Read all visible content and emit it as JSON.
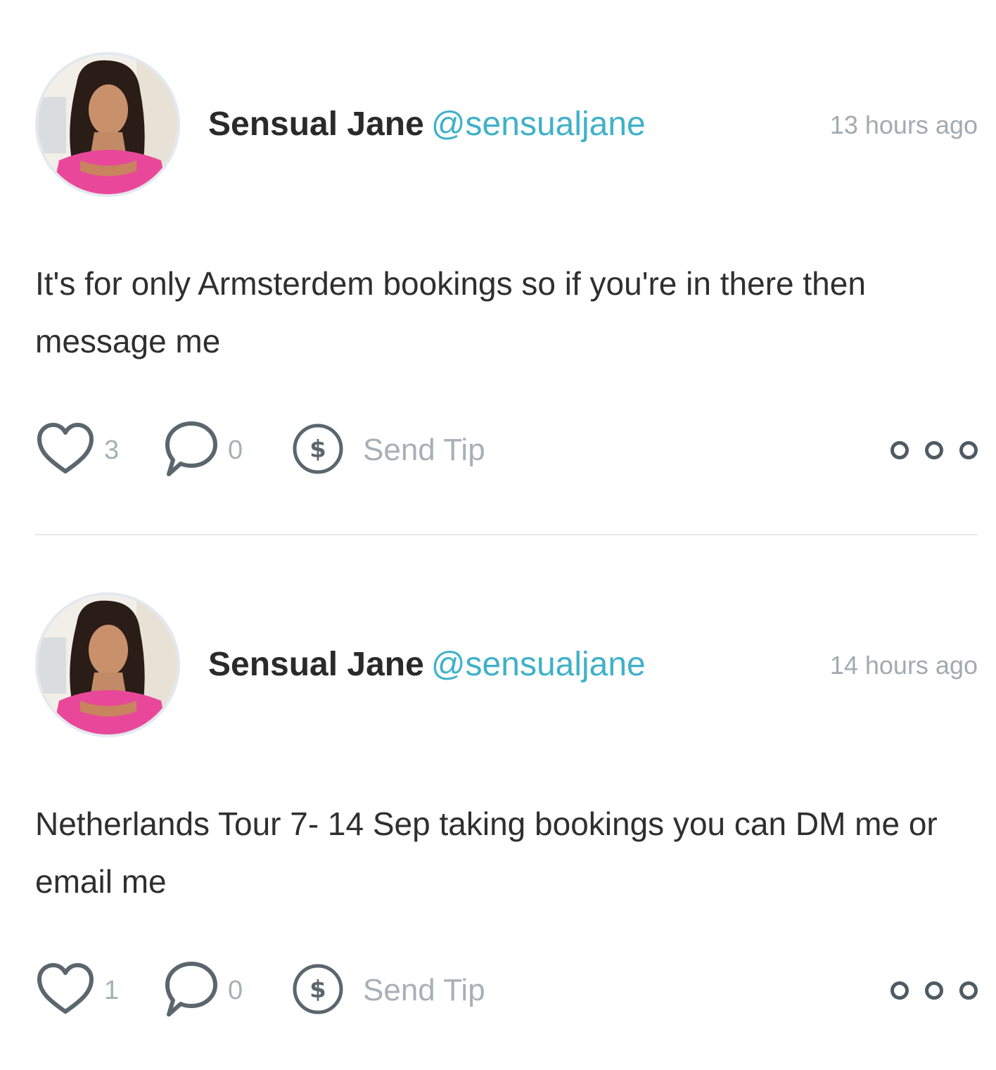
{
  "feed": {
    "posts": [
      {
        "author_name": "Sensual Jane",
        "author_handle": "@sensualjane",
        "time": "13 hours ago",
        "text": "It's for only Armsterdem bookings so if you're in there then message me",
        "likes": "3",
        "comments": "0",
        "tip_label": "Send Tip",
        "icons": {
          "like": "heart-icon",
          "comment": "speech-bubble-icon",
          "tip": "dollar-coin-icon",
          "more": "more-dots-icon"
        }
      },
      {
        "author_name": "Sensual Jane",
        "author_handle": "@sensualjane",
        "time": "14 hours ago",
        "text": "Netherlands Tour 7- 14 Sep taking bookings you can DM me or email me",
        "likes": "1",
        "comments": "0",
        "tip_label": "Send Tip",
        "icons": {
          "like": "heart-icon",
          "comment": "speech-bubble-icon",
          "tip": "dollar-coin-icon",
          "more": "more-dots-icon"
        }
      }
    ]
  },
  "colors": {
    "handle": "#3fb1c9",
    "name": "#2a2a2a",
    "muted": "#a9b0b5",
    "icon": "#5b666d",
    "divider": "#e2e8ec"
  }
}
